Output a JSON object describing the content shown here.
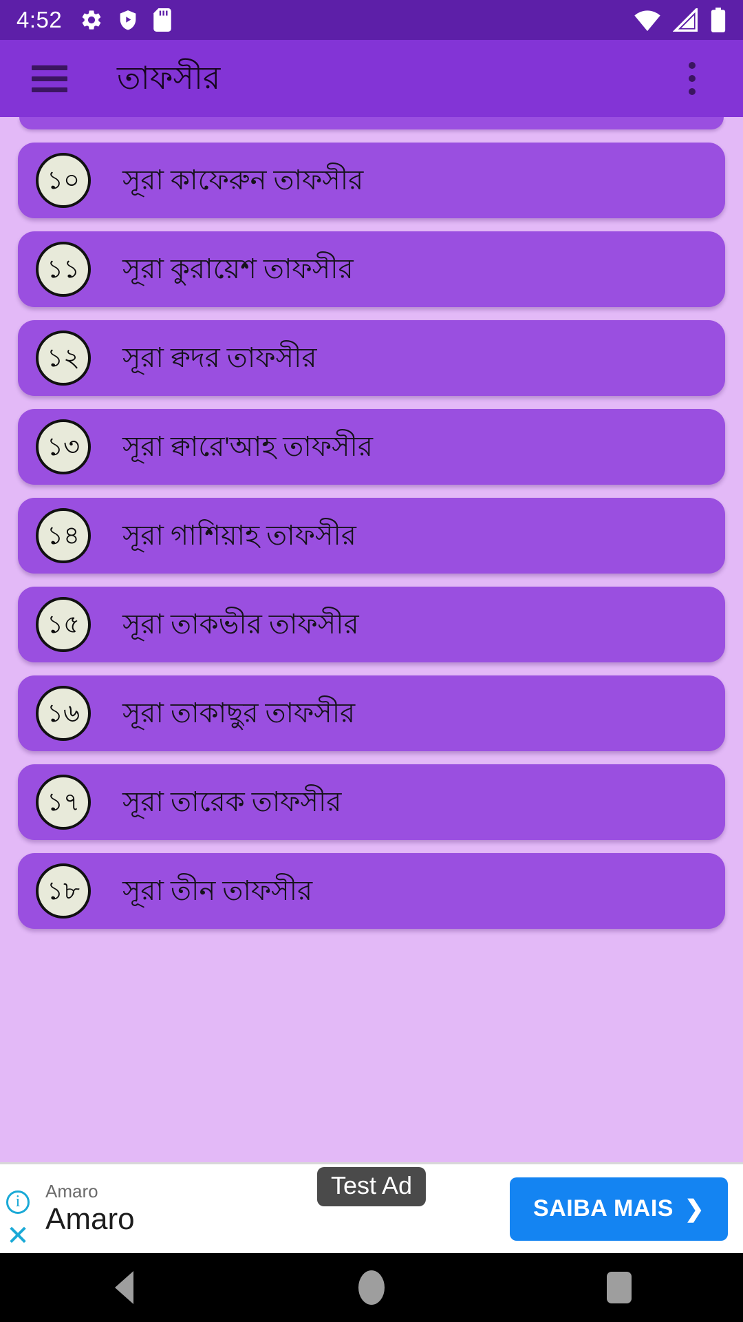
{
  "status_bar": {
    "clock": "4:52",
    "left_icons": [
      "gear-icon",
      "shield-play-icon",
      "sd-card-icon"
    ],
    "right_icons": [
      "wifi-icon",
      "cellular-signal-icon",
      "battery-icon"
    ],
    "background_color": "#5d1fa8"
  },
  "app_bar": {
    "title": "তাফসীর",
    "menu_icon": "hamburger-menu-icon",
    "overflow_icon": "more-vertical-icon",
    "background_color": "#8334d6"
  },
  "list": {
    "background_color": "#e3b9f7",
    "card_color": "#9a4fe0",
    "badge_color": "#e8eada",
    "items": [
      {
        "number": "১০",
        "label": "সূরা কাফেরুন তাফসীর"
      },
      {
        "number": "১১",
        "label": "সূরা কুরায়েশ তাফসীর"
      },
      {
        "number": "১২",
        "label": "সূরা ক্বদর তাফসীর"
      },
      {
        "number": "১৩",
        "label": "সূরা ক্বারে'আহ তাফসীর"
      },
      {
        "number": "১৪",
        "label": "সূরা গাশিয়াহ তাফসীর"
      },
      {
        "number": "১৫",
        "label": "সূরা তাকভীর তাফসীর"
      },
      {
        "number": "১৬",
        "label": "সূরা তাকাছুর তাফসীর"
      },
      {
        "number": "১৭",
        "label": "সূরা তারেক তাফসীর"
      },
      {
        "number": "১৮",
        "label": "সূরা তীন তাফসীর"
      }
    ]
  },
  "ad": {
    "advertiser": "Amaro",
    "headline": "Amaro",
    "test_badge": "Test Ad",
    "cta_label": "SAIBA MAIS",
    "cta_color": "#1484f2",
    "info_icon": "info-icon",
    "close_icon": "close-icon",
    "chevron_icon": "chevron-right-icon"
  },
  "nav_bar": {
    "back": "back-triangle-icon",
    "home": "home-circle-icon",
    "recents": "recents-square-icon",
    "background_color": "#000000"
  }
}
